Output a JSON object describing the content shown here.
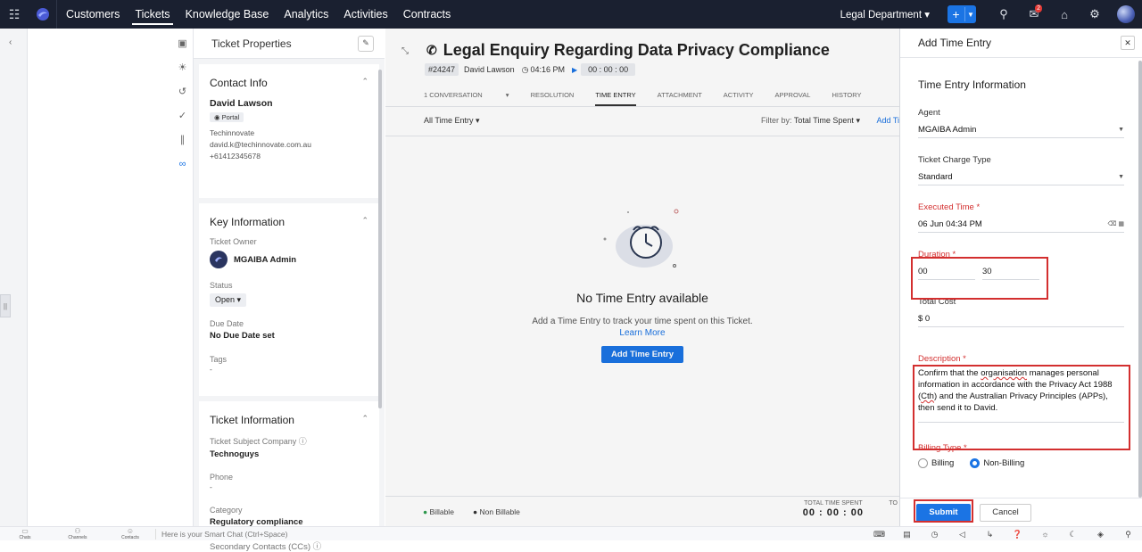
{
  "nav": {
    "items": [
      "Customers",
      "Tickets",
      "Knowledge Base",
      "Analytics",
      "Activities",
      "Contracts"
    ],
    "active": "Tickets"
  },
  "top": {
    "department": "Legal Department",
    "notification_count": "2",
    "plus": "+"
  },
  "props": {
    "title": "Ticket Properties",
    "contact": {
      "header": "Contact Info",
      "name": "David Lawson",
      "tag": "Portal",
      "company": "Techinnovate",
      "email": "david.k@techinnovate.com.au",
      "phone": "+61412345678"
    },
    "key": {
      "header": "Key Information",
      "owner_label": "Ticket Owner",
      "owner": "MGAIBA Admin",
      "status_label": "Status",
      "status": "Open",
      "due_label": "Due Date",
      "due": "No Due Date set",
      "tags_label": "Tags",
      "tags": "-"
    },
    "ticket": {
      "header": "Ticket Information",
      "company_label": "Ticket Subject Company",
      "company": "Technoguys",
      "phone_label": "Phone",
      "phone": "-",
      "category_label": "Category",
      "category": "Regulatory compliance",
      "cc_label": "Secondary Contacts (CCs)"
    }
  },
  "ticket": {
    "subject": "Legal Enquiry Regarding Data Privacy Compliance",
    "number": "#24247",
    "contact": "David Lawson",
    "time": "04:16 PM",
    "timer": "00 : 00 : 00",
    "tabs": [
      "1 CONVERSATION",
      "RESOLUTION",
      "TIME ENTRY",
      "ATTACHMENT",
      "ACTIVITY",
      "APPROVAL",
      "HISTORY"
    ],
    "active_tab": "TIME ENTRY",
    "filter_left": "All Time Entry",
    "filter_label": "Filter by:",
    "filter_value": "Total Time Spent",
    "add_link": "Add Ti"
  },
  "empty": {
    "title": "No Time Entry available",
    "text": "Add a Time Entry to track your time spent on this Ticket.",
    "link": "Learn More",
    "button": "Add Time Entry"
  },
  "footer": {
    "billable": "Billable",
    "non_billable": "Non Billable",
    "total_label": "TOTAL TIME SPENT",
    "total": "00 : 00 : 00",
    "to": "TO"
  },
  "panel": {
    "title": "Add Time Entry",
    "section": "Time Entry Information",
    "agent_label": "Agent",
    "agent": "MGAIBA Admin",
    "charge_label": "Ticket Charge Type",
    "charge": "Standard",
    "executed_label": "Executed Time",
    "executed": "06 Jun 04:34 PM",
    "duration_label": "Duration",
    "duration_h": "00",
    "duration_m": "30",
    "cost_label": "Total Cost",
    "cost": "$ 0",
    "desc_label": "Description",
    "desc_1": "Confirm that the ",
    "desc_2": "organisation",
    "desc_3": " manages personal information in accordance with the Privacy Act 1988 (",
    "desc_4": "Cth",
    "desc_5": ") and the Australian Privacy Principles (APPs), then send it to David.",
    "billing_label": "Billing Type",
    "billing_options": [
      "Billing",
      "Non-Billing"
    ],
    "billing_selected": "Non-Billing",
    "submit": "Submit",
    "cancel": "Cancel"
  },
  "bottom": {
    "chats": "Chats",
    "channels": "Channels",
    "contacts": "Contacts",
    "smartchat": "Here is your Smart Chat (Ctrl+Space)"
  },
  "colors": {
    "accent": "#1b74e4",
    "topbar": "#1a2030",
    "required": "#d32f2f"
  }
}
